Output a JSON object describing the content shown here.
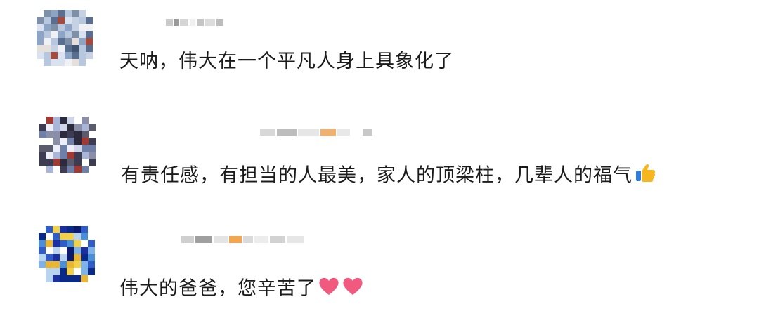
{
  "comments": [
    {
      "text": "天呐，伟大在一个平凡人身上具象化了",
      "emojis": []
    },
    {
      "text": "有责任感，有担当的人最美，家人的顶梁柱，几辈人的福气",
      "emojis": [
        "thumbs-up-icon"
      ]
    },
    {
      "text": "伟大的爸爸，您辛苦了",
      "emojis": [
        "heart-icon",
        "heart-icon"
      ]
    }
  ]
}
